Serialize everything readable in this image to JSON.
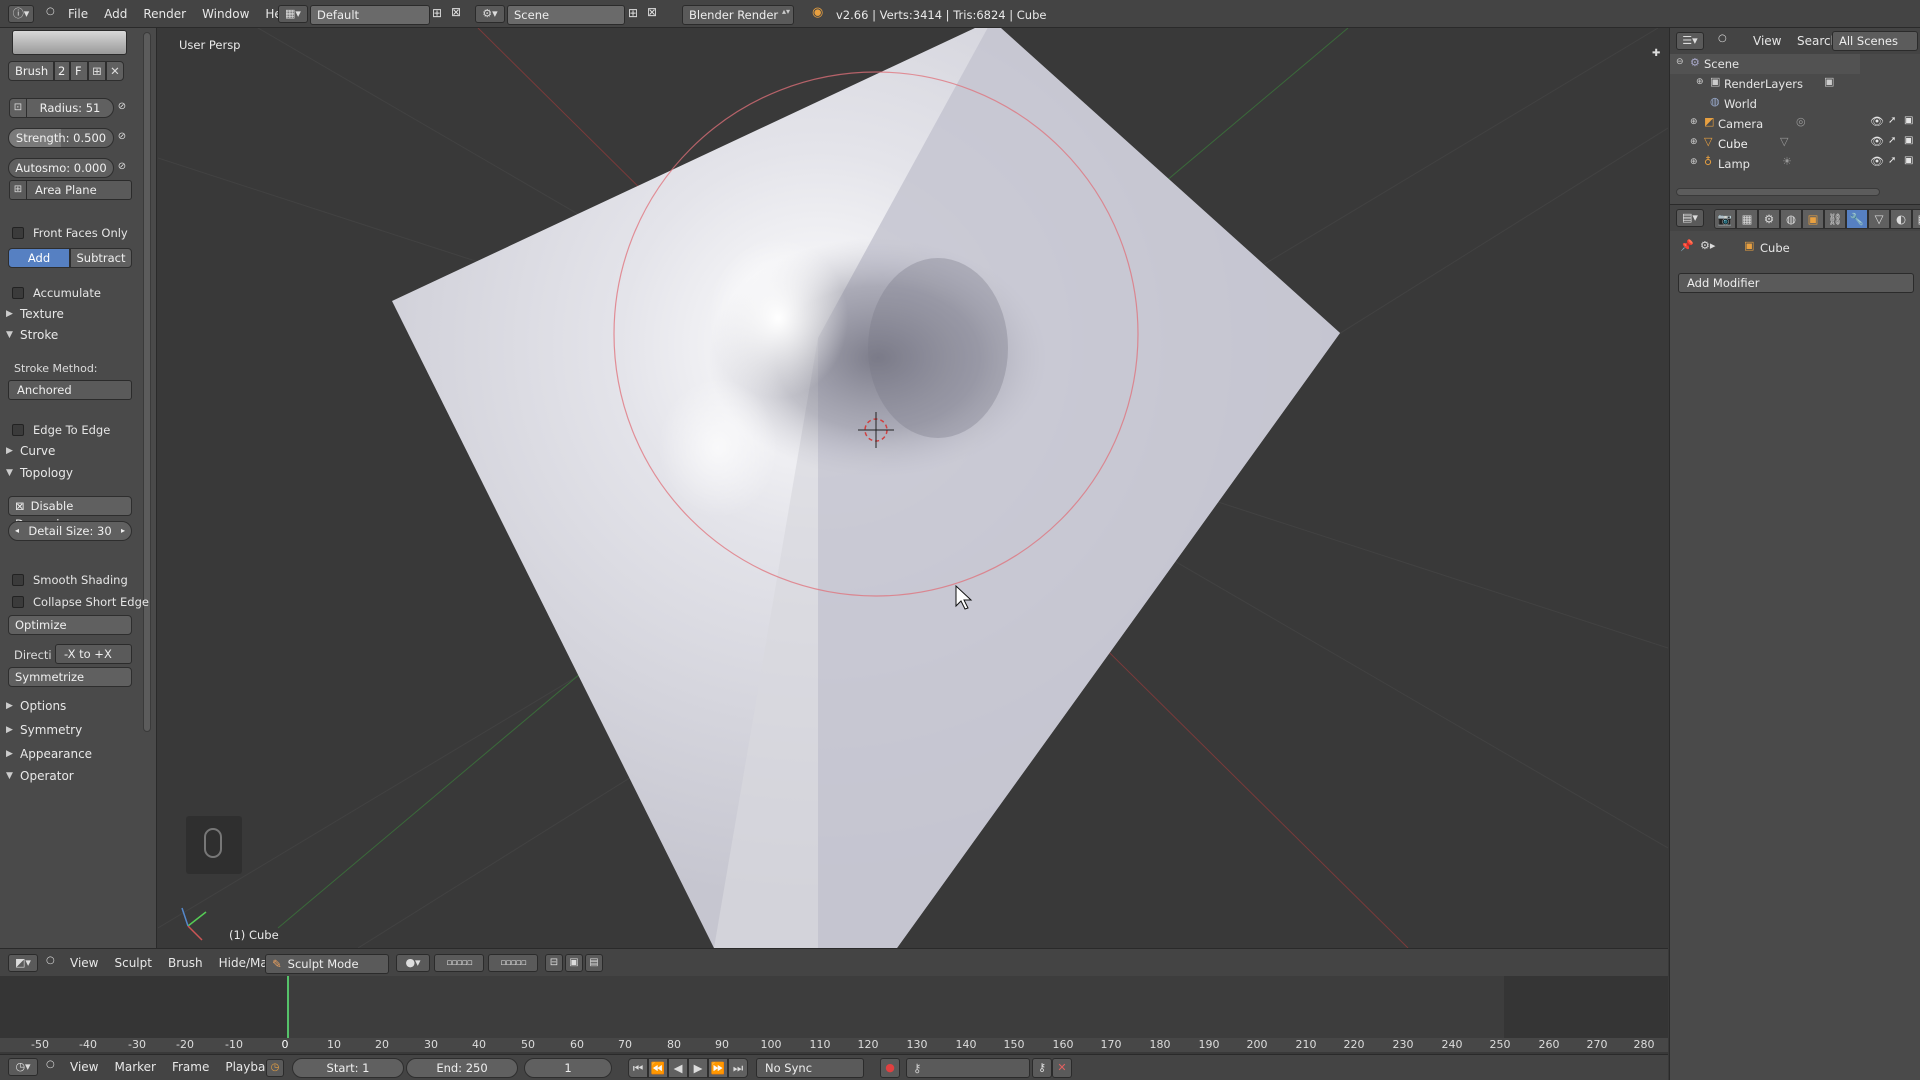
{
  "info_header": {
    "menus": [
      "File",
      "Add",
      "Render",
      "Window",
      "Help"
    ],
    "layout": "Default",
    "scene": "Scene",
    "engine": "Blender Render",
    "stats": "v2.66 | Verts:3414 | Tris:6824 | Cube"
  },
  "tool_shelf": {
    "brush_name": "Brush",
    "brush_users": "2",
    "brush_fake": "F",
    "radius": "Radius: 51",
    "strength": "Strength: 0.500",
    "autosmooth": "Autosmo: 0.000",
    "sculpt_plane": "Area Plane",
    "front_faces_only": "Front Faces Only",
    "add": "Add",
    "subtract": "Subtract",
    "accumulate": "Accumulate",
    "texture": "Texture",
    "stroke": "Stroke",
    "stroke_method_label": "Stroke Method:",
    "stroke_method": "Anchored",
    "edge_to_edge": "Edge To Edge",
    "curve": "Curve",
    "topology": "Topology",
    "disable_dynamic": "Disable Dynamic",
    "detail_size": "Detail Size: 30",
    "smooth_shading": "Smooth Shading",
    "collapse_short_edge": "Collapse Short Edge",
    "optimize": "Optimize",
    "direction_label": "Directi",
    "direction": "-X to +X",
    "symmetrize": "Symmetrize",
    "options": "Options",
    "symmetry": "Symmetry",
    "appearance": "Appearance",
    "operator": "Operator"
  },
  "viewport": {
    "view_name": "User Persp",
    "object_label": "(1) Cube"
  },
  "view3d_header": {
    "menus": [
      "View",
      "Sculpt",
      "Brush",
      "Hide/Mask"
    ],
    "mode": "Sculpt Mode"
  },
  "outliner": {
    "menus": [
      "View",
      "Search"
    ],
    "filter": "All Scenes",
    "items": [
      {
        "name": "Scene"
      },
      {
        "name": "RenderLayers"
      },
      {
        "name": "World"
      },
      {
        "name": "Camera"
      },
      {
        "name": "Cube"
      },
      {
        "name": "Lamp"
      }
    ]
  },
  "properties": {
    "context": "Cube",
    "add_modifier": "Add Modifier"
  },
  "timeline": {
    "ticks": [
      "-50",
      "-40",
      "-30",
      "-20",
      "-10",
      "0",
      "10",
      "20",
      "30",
      "40",
      "50",
      "60",
      "70",
      "80",
      "90",
      "100",
      "110",
      "120",
      "130",
      "140",
      "150",
      "160",
      "170",
      "180",
      "190",
      "200",
      "210",
      "220",
      "230",
      "240",
      "250",
      "260",
      "270",
      "280"
    ],
    "menus": [
      "View",
      "Marker",
      "Frame",
      "Playback"
    ],
    "start": "Start: 1",
    "end": "End: 250",
    "current": "1",
    "sync": "No Sync"
  },
  "colors": {
    "accent_blue": "#5680c2",
    "brush_circle": "#e0707a",
    "playhead": "#56c26a"
  }
}
